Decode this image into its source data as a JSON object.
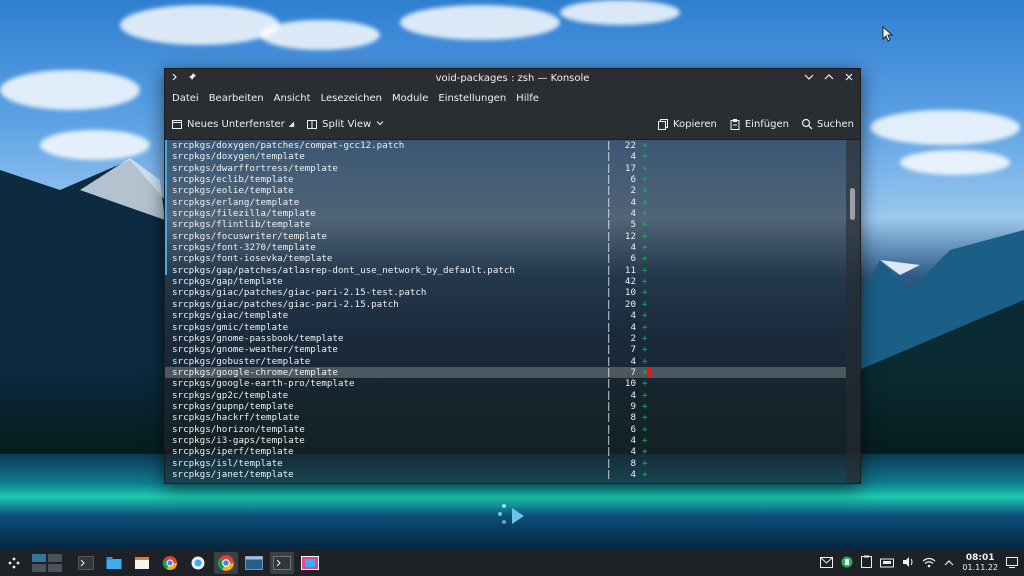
{
  "window": {
    "title": "void-packages : zsh — Konsole"
  },
  "menu": [
    "Datei",
    "Bearbeiten",
    "Ansicht",
    "Lesezeichen",
    "Module",
    "Einstellungen",
    "Hilfe"
  ],
  "toolbar": {
    "new_tab": "Neues Unterfenster",
    "split_view": "Split View",
    "copy": "Kopieren",
    "paste": "Einfügen",
    "search": "Suchen"
  },
  "terminal": {
    "rows": [
      {
        "path": "srcpkgs/doxygen/patches/compat-gcc12.patch",
        "count": "22"
      },
      {
        "path": "srcpkgs/doxygen/template",
        "count": "4"
      },
      {
        "path": "srcpkgs/dwarffortress/template",
        "count": "17"
      },
      {
        "path": "srcpkgs/eclib/template",
        "count": "6"
      },
      {
        "path": "srcpkgs/eolie/template",
        "count": "2"
      },
      {
        "path": "srcpkgs/erlang/template",
        "count": "4"
      },
      {
        "path": "srcpkgs/filezilla/template",
        "count": "4"
      },
      {
        "path": "srcpkgs/flintlib/template",
        "count": "5"
      },
      {
        "path": "srcpkgs/focuswriter/template",
        "count": "12"
      },
      {
        "path": "srcpkgs/font-3270/template",
        "count": "4"
      },
      {
        "path": "srcpkgs/font-iosevka/template",
        "count": "6"
      },
      {
        "path": "srcpkgs/gap/patches/atlasrep-dont_use_network_by_default.patch",
        "count": "11"
      },
      {
        "path": "srcpkgs/gap/template",
        "count": "42"
      },
      {
        "path": "srcpkgs/giac/patches/giac-pari-2.15-test.patch",
        "count": "10"
      },
      {
        "path": "srcpkgs/giac/patches/giac-pari-2.15.patch",
        "count": "20"
      },
      {
        "path": "srcpkgs/giac/template",
        "count": "4"
      },
      {
        "path": "srcpkgs/gmic/template",
        "count": "4"
      },
      {
        "path": "srcpkgs/gnome-passbook/template",
        "count": "2"
      },
      {
        "path": "srcpkgs/gnome-weather/template",
        "count": "7"
      },
      {
        "path": "srcpkgs/gobuster/template",
        "count": "4"
      },
      {
        "path": "srcpkgs/google-chrome/template",
        "count": "7"
      },
      {
        "path": "srcpkgs/google-earth-pro/template",
        "count": "10"
      },
      {
        "path": "srcpkgs/gp2c/template",
        "count": "4"
      },
      {
        "path": "srcpkgs/gupnp/template",
        "count": "9"
      },
      {
        "path": "srcpkgs/hackrf/template",
        "count": "8"
      },
      {
        "path": "srcpkgs/horizon/template",
        "count": "6"
      },
      {
        "path": "srcpkgs/i3-gaps/template",
        "count": "4"
      },
      {
        "path": "srcpkgs/iperf/template",
        "count": "4"
      },
      {
        "path": "srcpkgs/isl/template",
        "count": "8"
      },
      {
        "path": "srcpkgs/janet/template",
        "count": "4"
      }
    ],
    "selected_index": 20,
    "pipe": "|",
    "plus": "+"
  },
  "clock": {
    "time": "08:01",
    "date": "01.11.22"
  },
  "colors": {
    "accent": "#3daee9",
    "plus": "#27ae60",
    "minus": "#ed1515"
  }
}
